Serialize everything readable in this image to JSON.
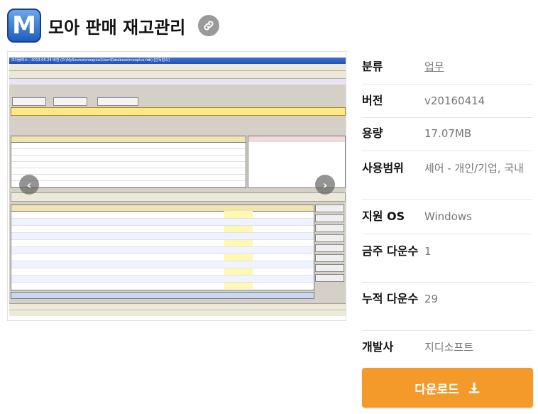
{
  "app": {
    "title": "모아 판매 재고관리",
    "icon_letter": "M"
  },
  "icons": {
    "link": "link-icon",
    "download": "download-icon",
    "prev": "chevron-left-icon",
    "next": "chevron-right-icon"
  },
  "screenshot": {
    "window_title": "모아플러스 - 2013.05.24 버전  (D:\\MySource\\moaplus\\User\\Database\\moaplus.fdb) [단독접속]"
  },
  "info": {
    "category_label": "분류",
    "category_value": "업무",
    "version_label": "버전",
    "version_value": "v20160414",
    "size_label": "용량",
    "size_value": "17.07MB",
    "license_label": "사용범위",
    "license_value": "셰어 - 개인/기업, 국내",
    "os_label": "지원 OS",
    "os_value": "Windows",
    "weekly_label": "금주 다운수",
    "weekly_value": "1",
    "total_label": "누적 다운수",
    "total_value": "29",
    "dev_label": "개발사",
    "dev_value": "지디소프트"
  },
  "download_button": "다운로드",
  "colors": {
    "accent": "#f39a2b",
    "label": "#111111",
    "value": "#777777"
  }
}
